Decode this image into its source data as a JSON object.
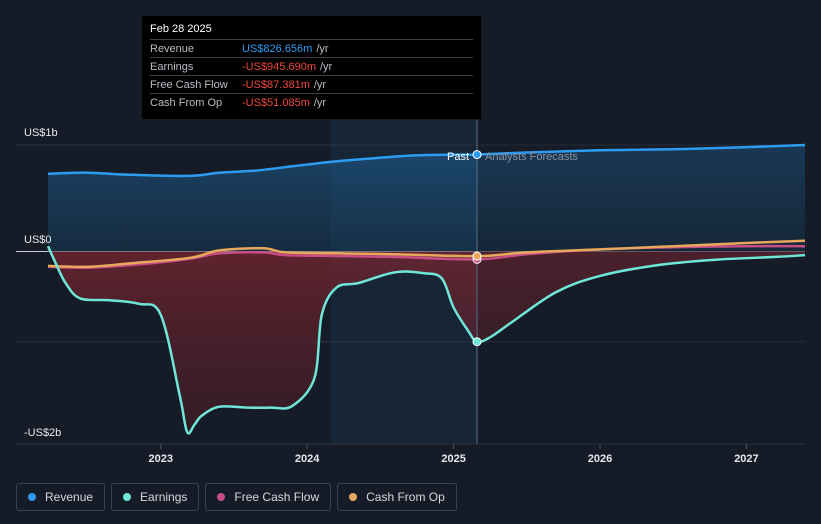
{
  "tooltip": {
    "date": "Feb 28 2025",
    "rows": [
      {
        "label": "Revenue",
        "value": "US$826.656m",
        "unit": "/yr",
        "color": "#2d9cf0"
      },
      {
        "label": "Earnings",
        "value": "-US$945.690m",
        "unit": "/yr",
        "color": "#f0493e"
      },
      {
        "label": "Free Cash Flow",
        "value": "-US$87.381m",
        "unit": "/yr",
        "color": "#f0493e"
      },
      {
        "label": "Cash From Op",
        "value": "-US$51.085m",
        "unit": "/yr",
        "color": "#f0493e"
      }
    ]
  },
  "legend": [
    {
      "label": "Revenue",
      "color": "#2d9cf0"
    },
    {
      "label": "Earnings",
      "color": "#6ee7d8"
    },
    {
      "label": "Free Cash Flow",
      "color": "#c64d85"
    },
    {
      "label": "Cash From Op",
      "color": "#e7a85c"
    }
  ],
  "chart_data": {
    "type": "area",
    "y_axis_labels": [
      "US$1b",
      "US$0",
      "-US$2b"
    ],
    "ylim": [
      -2,
      1
    ],
    "y_unit": "US$b",
    "x_ticks": [
      "2023",
      "2024",
      "2025",
      "2026",
      "2027"
    ],
    "x_tick_values": [
      2023.0,
      2024.0,
      2025.0,
      2026.0,
      2027.0
    ],
    "xlim": [
      2022.23,
      2027.4
    ],
    "past_label": "Past",
    "forecast_label": "Analysts Forecasts",
    "divider_x": 2025.16,
    "highlight_start_x": 2024.16,
    "series": [
      {
        "name": "Revenue",
        "color": "#2d9cf0",
        "x": [
          2022.23,
          2022.5,
          2022.8,
          2023.2,
          2023.4,
          2023.65,
          2023.9,
          2024.15,
          2024.4,
          2024.7,
          2025.0,
          2025.16,
          2025.5,
          2026.0,
          2026.5,
          2027.0,
          2027.4
        ],
        "y": [
          0.73,
          0.74,
          0.72,
          0.71,
          0.74,
          0.76,
          0.8,
          0.84,
          0.87,
          0.9,
          0.91,
          0.91,
          0.93,
          0.95,
          0.96,
          0.98,
          1.0
        ]
      },
      {
        "name": "Earnings",
        "color": "#6ee7d8",
        "x": [
          2022.23,
          2022.28,
          2022.35,
          2022.45,
          2022.65,
          2022.85,
          2023.0,
          2023.13,
          2023.18,
          2023.23,
          2023.28,
          2023.4,
          2023.6,
          2023.75,
          2023.9,
          2024.05,
          2024.1,
          2024.2,
          2024.35,
          2024.6,
          2024.8,
          2024.92,
          2025.0,
          2025.1,
          2025.16,
          2025.25,
          2025.4,
          2025.7,
          2026.0,
          2026.4,
          2026.8,
          2027.2,
          2027.4
        ],
        "y": [
          0.05,
          -0.12,
          -0.35,
          -0.52,
          -0.54,
          -0.58,
          -0.7,
          -1.6,
          -2.0,
          -1.92,
          -1.82,
          -1.72,
          -1.73,
          -1.73,
          -1.71,
          -1.4,
          -0.7,
          -0.4,
          -0.35,
          -0.23,
          -0.24,
          -0.3,
          -0.62,
          -0.88,
          -1.0,
          -0.95,
          -0.78,
          -0.45,
          -0.27,
          -0.15,
          -0.09,
          -0.06,
          -0.04
        ]
      },
      {
        "name": "Free Cash Flow",
        "color": "#c64d85",
        "x": [
          2022.23,
          2022.5,
          2022.8,
          2023.2,
          2023.4,
          2023.7,
          2023.85,
          2024.2,
          2024.6,
          2025.16,
          2025.5,
          2026.0,
          2026.5,
          2027.0,
          2027.4
        ],
        "y": [
          -0.17,
          -0.18,
          -0.15,
          -0.08,
          -0.02,
          -0.01,
          -0.04,
          -0.05,
          -0.06,
          -0.087,
          -0.03,
          0.02,
          0.04,
          0.05,
          0.05
        ]
      },
      {
        "name": "Cash From Op",
        "color": "#e7a85c",
        "x": [
          2022.23,
          2022.5,
          2022.8,
          2023.2,
          2023.4,
          2023.7,
          2023.85,
          2024.2,
          2024.6,
          2025.16,
          2025.5,
          2026.0,
          2026.5,
          2027.0,
          2027.4
        ],
        "y": [
          -0.16,
          -0.17,
          -0.13,
          -0.07,
          0.01,
          0.03,
          -0.01,
          -0.02,
          -0.03,
          -0.051,
          -0.01,
          0.02,
          0.05,
          0.08,
          0.1
        ]
      }
    ]
  }
}
